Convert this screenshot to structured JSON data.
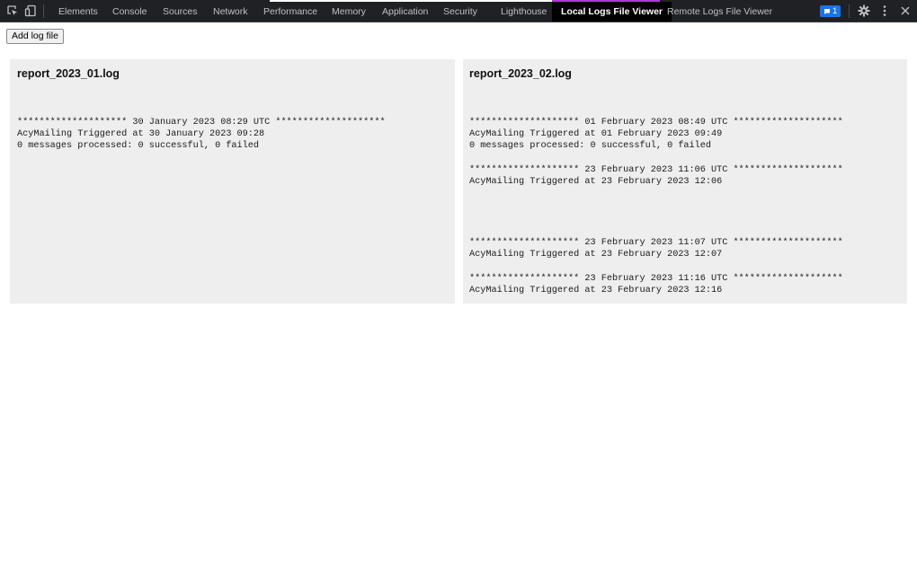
{
  "devtools": {
    "tabs": [
      {
        "label": "Elements"
      },
      {
        "label": "Console"
      },
      {
        "label": "Sources"
      },
      {
        "label": "Network"
      },
      {
        "label": "Performance"
      },
      {
        "label": "Memory"
      },
      {
        "label": "Application"
      },
      {
        "label": "Security"
      },
      {
        "label": "Lighthouse"
      },
      {
        "label": "Local Logs File Viewer",
        "active": true
      },
      {
        "label": "Remote Logs File Viewer"
      }
    ],
    "issues_count": "1",
    "icons": [
      "inspect-element-icon",
      "device-toolbar-icon",
      "issues-icon",
      "settings-gear-icon",
      "more-options-icon",
      "close-icon"
    ],
    "colors": {
      "bar": "#202124",
      "active_tab": "#000000",
      "badge": "#1a73e8",
      "accent_strip": "#b039d9"
    }
  },
  "toolbar": {
    "add_button_label": "Add log file"
  },
  "logs": [
    {
      "title": "report_2023_01.log",
      "lines": [
        "******************** 30 January 2023 08:29 UTC ********************",
        "AcyMailing Triggered at 30 January 2023 09:28",
        "0 messages processed: 0 successful, 0 failed"
      ]
    },
    {
      "title": "report_2023_02.log",
      "lines": [
        "******************** 01 February 2023 08:49 UTC ********************",
        "AcyMailing Triggered at 01 February 2023 09:49",
        "0 messages processed: 0 successful, 0 failed",
        "******************** 23 February 2023 11:06 UTC ********************",
        "AcyMailing Triggered at 23 February 2023 12:06",
        "******************** 23 February 2023 11:07 UTC ********************",
        "AcyMailing Triggered at 23 February 2023 12:07",
        "******************** 23 February 2023 11:16 UTC ********************",
        "AcyMailing Triggered at 23 February 2023 12:16"
      ]
    }
  ]
}
